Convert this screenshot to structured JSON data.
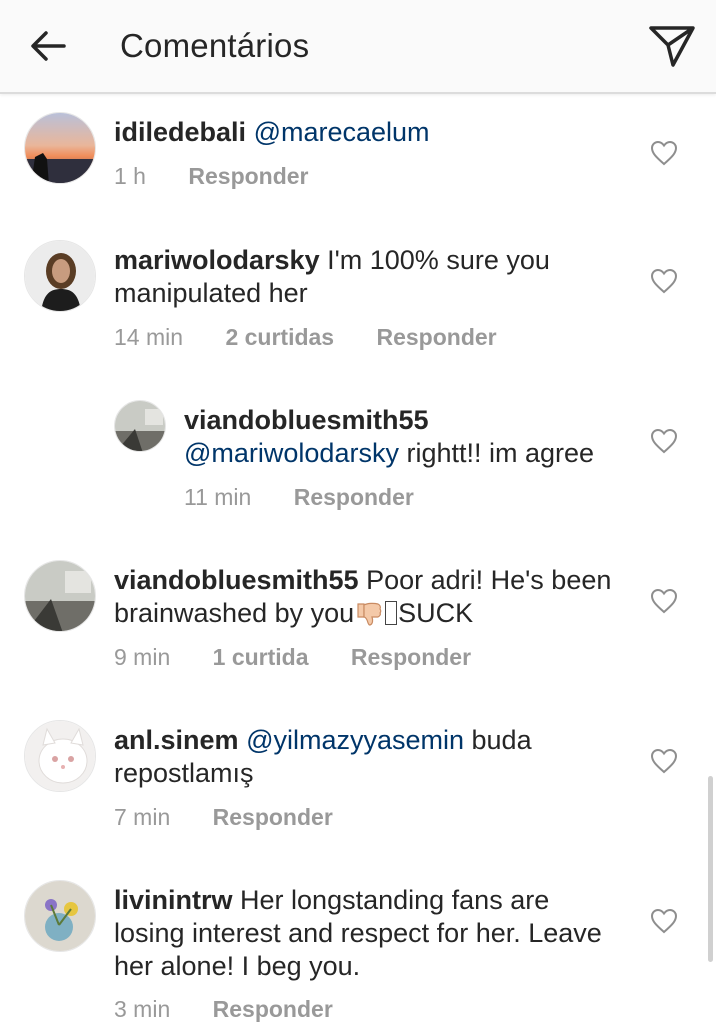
{
  "header": {
    "title": "Comentários",
    "back_icon": "arrow-left-icon",
    "send_icon": "paper-plane-icon"
  },
  "colors": {
    "mention": "#003569",
    "meta": "#999999",
    "text": "#262626"
  },
  "comments": [
    {
      "username": "idiledebali",
      "mention": "@marecaelum",
      "text": "",
      "time": "1 h",
      "likes": "",
      "reply": "Responder"
    },
    {
      "username": "mariwolodarsky",
      "text_line1": "I'm 100% sure you",
      "text_line2": "manipulated her",
      "time": "14 min",
      "likes": "2 curtidas",
      "reply": "Responder"
    },
    {
      "username": "viandobluesmith55",
      "mention": "@mariwolodarsky",
      "text": " rightt!! im agree",
      "time": "11 min",
      "reply": "Responder"
    },
    {
      "username": "viandobluesmith55",
      "text_line1": "Poor adri! He's been",
      "text_line2a": "brainwashed by you",
      "text_line2b": "SUCK",
      "time": "9 min",
      "likes": "1 curtida",
      "reply": "Responder"
    },
    {
      "username": "anl.sinem",
      "mention": "@yilmazyyasemin",
      "text_line1": " buda",
      "text_line2": "repostlamış",
      "time": "7 min",
      "reply": "Responder"
    },
    {
      "username": "livinintrw",
      "text_line1": "Her longstanding fans are",
      "text_line2": "losing interest and respect for her. Leave",
      "text_line3": "her alone! I beg you.",
      "time": "3 min",
      "reply": "Responder"
    }
  ]
}
